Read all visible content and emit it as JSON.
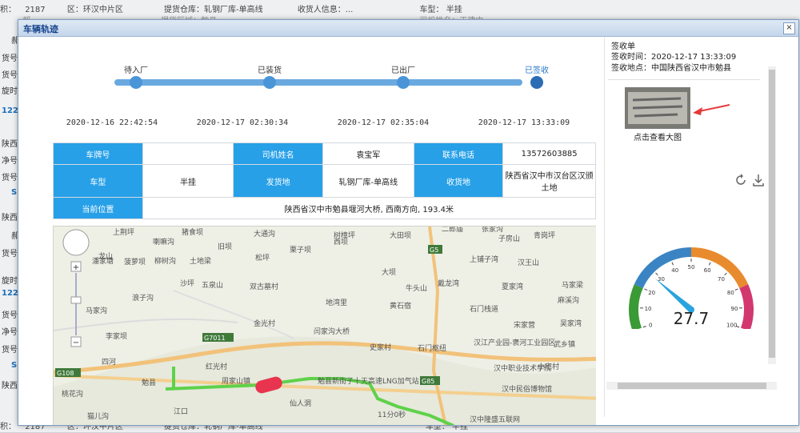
{
  "background": {
    "top_row": [
      "积：",
      "2187",
      "区：环汉中片区",
      "提货仓库：轧钢厂库-单高线",
      "收货人信息：...",
      "车型：",
      "半挂"
    ],
    "row2": [
      "郝",
      "...",
      "提货区域：勉县",
      "...",
      "司机姓名：王建中"
    ],
    "bottom_row": [
      "积：",
      "2187",
      "区：环汉中片区",
      "提货仓库：轧钢厂库-单高线",
      "车型：",
      "半挂"
    ],
    "left_items": [
      {
        "text": "郝",
        "blue": false
      },
      {
        "text": "货号：",
        "blue": false
      },
      {
        "text": "货号：",
        "blue": false
      },
      {
        "text": "旋时间",
        "blue": false
      },
      {
        "text": "1220",
        "blue": true
      },
      {
        "text": "陕西",
        "blue": false
      },
      {
        "text": "净号：",
        "blue": false
      },
      {
        "text": "货号：",
        "blue": false
      },
      {
        "text": "S",
        "blue": true
      },
      {
        "text": "陕西",
        "blue": false
      },
      {
        "text": "郝",
        "blue": false
      },
      {
        "text": "货号：",
        "blue": false
      },
      {
        "text": "旋时间",
        "blue": false
      },
      {
        "text": "1220",
        "blue": true
      },
      {
        "text": "货号：",
        "blue": false
      },
      {
        "text": "净号：",
        "blue": false
      },
      {
        "text": "货号：",
        "blue": false
      },
      {
        "text": "S",
        "blue": true
      },
      {
        "text": "陕西",
        "blue": false
      }
    ]
  },
  "modal": {
    "title": "车辆轨迹",
    "close_label": "×"
  },
  "steps": [
    {
      "label": "待入厂",
      "time": "2020-12-16 22:42:54"
    },
    {
      "label": "已装货",
      "time": "2020-12-17 02:30:34"
    },
    {
      "label": "已出厂",
      "time": "2020-12-17 02:35:04"
    },
    {
      "label": "已签收",
      "time": "2020-12-17 13:33:09"
    }
  ],
  "info_table": {
    "plate_label": "车牌号",
    "plate_value": "",
    "driver_label": "司机姓名",
    "driver_value": "袁宝军",
    "phone_label": "联系电话",
    "phone_value": "13572603885",
    "vehicle_label": "车型",
    "vehicle_value": "半挂",
    "origin_label": "发货地",
    "origin_value": "轧钢厂库-单高线",
    "dest_label": "收货地",
    "dest_value": "陕西省汉中市汉台区汉颁土地",
    "location_label": "当前位置",
    "location_value": "陕西省汉中市勉县堰河大桥, 西南方向, 193.4米"
  },
  "map": {
    "labels": [
      "上荆坪",
      "猪食坝",
      "大通沟",
      "树樟坪",
      "大田坝",
      "二郎庙",
      "张家沟",
      "青岗坪",
      "龙山",
      "喇嘛沟",
      "旧坝",
      "潘家塘",
      "栗子坝",
      "西坝",
      "子房山",
      "菠萝坝",
      "柳树沟",
      "土地梁",
      "松坪",
      "上铺子湾",
      "汉王山",
      "马家沟",
      "浪子沟",
      "沙坪",
      "五泉山",
      "双古墓村",
      "大坝",
      "牛头山",
      "戴龙湾",
      "夏家湾",
      "马家梁",
      "麻溪沟",
      "地湾里",
      "黄石宿",
      "石门栈道",
      "宋家营",
      "吴家湾",
      "李家坝",
      "金光村",
      "闫家沟大桥",
      "石门枢纽",
      "汉江产业园-褒河工业园区",
      "武乡镇",
      "四河",
      "史家村",
      "汉中职业技术学院",
      "小宅村",
      "红光村",
      "周家山镇",
      "勉县新街子十天高速LNG加气站",
      "汉中民俗博物馆",
      "勉县",
      "仙人洞",
      "桃花沟",
      "江口",
      "猫儿沟",
      "汉中隆盛五联网",
      "11分0秒"
    ],
    "road_labels": [
      "G5",
      "G7011",
      "G85",
      "G108"
    ],
    "zoom_in": "+",
    "zoom_out": "−"
  },
  "signature": {
    "title": "签收单",
    "time_label": "签收时间：",
    "time_value": "2020-12-17 13:33:09",
    "place_label": "签收地点：",
    "place_value": "中国陕西省汉中市勉县",
    "thumb_caption": "点击查看大图"
  },
  "gauge": {
    "value": 27.7,
    "value_text": "27.7",
    "min": 0,
    "max": 100,
    "ticks": [
      "0",
      "10",
      "20",
      "30",
      "40",
      "50",
      "60",
      "70",
      "80",
      "90",
      "100"
    ],
    "colors": {
      "green": "#3a9a35",
      "blue": "#3b84c4",
      "orange": "#e88b2e",
      "pink": "#d2386e",
      "needle": "#2aa4de"
    }
  },
  "colors": {
    "accent": "#27a0e8",
    "route": "#5fd14a"
  }
}
